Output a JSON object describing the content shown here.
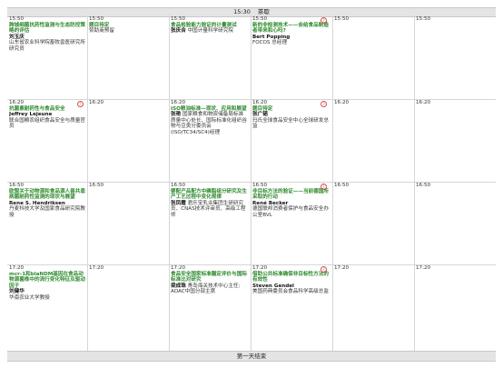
{
  "top_bar": {
    "time": "15:30",
    "label": "茶歇"
  },
  "bottom_bar": {
    "label": "第一天结束"
  },
  "rows": [
    {
      "cells": [
        {
          "time": "15:50",
          "title": "跨城细菌抗药性监测与生态防控策略的评估",
          "speaker": "刘玉庆",
          "desc": "山东省农业科学院畜牧兽医研究所研究员",
          "mark": false
        },
        {
          "time": "15:50",
          "title": "题目待定",
          "speaker": "",
          "desc": "赞助商预留",
          "mark": false
        },
        {
          "time": "15:50",
          "title": "食品检验能力验证的计量测试",
          "speaker": "张庆合",
          "desc": "中国计量科学研究院",
          "inline": true,
          "mark": false
        },
        {
          "time": "15:50",
          "title": "新的非检测技术——会给食品制造者带来和心吗?",
          "speaker": "Bert Popping",
          "desc": "FOCOS 总经理",
          "mark": true
        },
        {
          "time": "15:50",
          "title": "",
          "speaker": "",
          "desc": "",
          "mark": false
        },
        {
          "time": "15:50",
          "title": "",
          "speaker": "",
          "desc": "",
          "mark": false
        }
      ]
    },
    {
      "cells": [
        {
          "time": "16:20",
          "title": "抗菌素耐药性与食品安全",
          "speaker": "Jeffrey Lejeune",
          "desc": "联合国粮农组织食品安全与质量官员",
          "mark": true
        },
        {
          "time": "16:20",
          "title": "",
          "speaker": "",
          "desc": "",
          "mark": false
        },
        {
          "time": "16:20",
          "title": "ISO粮油标准—现状、应用和展望",
          "speaker": "张艳",
          "desc": "国家粮食和物资储备局标准质量中心处长、国际标准化组织谷物与豆类分委员会(ISO/TC34/SC4)经理",
          "inline": true,
          "mark": false
        },
        {
          "time": "16:20",
          "title": "题目待定",
          "speaker": "张广韬",
          "desc": "玛氏全球食品安全中心全球研发总监",
          "mark": true
        },
        {
          "time": "16:20",
          "title": "",
          "speaker": "",
          "desc": "",
          "mark": false
        },
        {
          "time": "16:20",
          "title": "",
          "speaker": "",
          "desc": "",
          "mark": false
        }
      ]
    },
    {
      "cells": [
        {
          "time": "16:50",
          "title": "欧盟关于动物源和食品源人兽共患病菌耐药性监测的现状与展望",
          "speaker": "Rene S. Hendriksen",
          "desc": "丹麦科技大学及国家食品研究院教授",
          "mark": false
        },
        {
          "time": "16:50",
          "title": "",
          "speaker": "",
          "desc": "",
          "mark": false
        },
        {
          "time": "16:50",
          "title": "婴配产品配方中磷脂组分研究及生产工艺过程中变化规律",
          "speaker": "张凤霞",
          "desc": "君乐宝乳业集团生研研究员、CNAS技术评审员、高级工程师",
          "inline": true,
          "mark": false
        },
        {
          "time": "16:50",
          "title": "非目标方法的验证——当前德国所采取的行动",
          "speaker": "René Becker",
          "desc": "德国联邦消费者保护与食品安全办公室BVL",
          "mark": true
        },
        {
          "time": "16:50",
          "title": "",
          "speaker": "",
          "desc": "",
          "mark": false
        },
        {
          "time": "16:50",
          "title": "",
          "speaker": "",
          "desc": "",
          "mark": false
        }
      ]
    },
    {
      "cells": [
        {
          "time": "17:20",
          "title": "mcr-1和blaNDM基因在食品动物源菌株中的流行变化特征及驱动因子",
          "speaker": "刘健华",
          "desc": "华南农业大学教授",
          "mark": false
        },
        {
          "time": "17:20",
          "title": "",
          "speaker": "",
          "desc": "",
          "mark": false
        },
        {
          "time": "17:20",
          "title": "食品安全国家标准膳定评价与国际标准比对研究",
          "speaker": "梁成珠",
          "desc": "青岛海关技术中心主任; AOAC中国分部主席",
          "inline": true,
          "mark": false
        },
        {
          "time": "17:20",
          "title": "借助公共标准确保非目标性方法的有效性",
          "speaker": "Steven Gendel",
          "desc": "美国药典委员会食品科学高级总监",
          "mark": true
        },
        {
          "time": "17:20",
          "title": "",
          "speaker": "",
          "desc": "",
          "mark": false
        },
        {
          "time": "17:20",
          "title": "",
          "speaker": "",
          "desc": "",
          "mark": false
        }
      ]
    }
  ]
}
